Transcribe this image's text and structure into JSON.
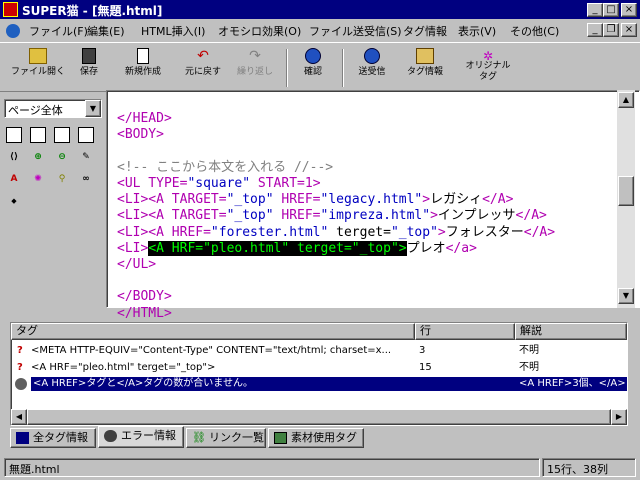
{
  "window": {
    "title": "SUPER猫 - [無題.html]",
    "min": "_",
    "max": "□",
    "close": "×"
  },
  "menubar": {
    "items": [
      "ファイル(F)",
      "編集(E)",
      "HTML挿入(I)",
      "オモシロ効果(O)",
      "ファイル送受信(S)",
      "タグ情報",
      "表示(V)",
      "その他(C)"
    ],
    "doc_min": "_",
    "doc_restore": "❐",
    "doc_close": "×"
  },
  "toolbar": {
    "open": "ファイル開く",
    "save": "保存",
    "new": "新規作成",
    "undo": "元に戻す",
    "redo": "繰り返し",
    "confirm": "確認",
    "transfer": "送受信",
    "taginfo": "タグ情報",
    "original1": "オリジナル",
    "original2": "タグ"
  },
  "leftpanel": {
    "page_select": "ページ全体"
  },
  "editor": {
    "l1": "</HEAD>",
    "l2": "<BODY>",
    "l3": "<!-- ここから本文を入れる //-->",
    "l4a": "<UL TYPE=",
    "l4b": "\"square\"",
    "l4c": " START=1>",
    "l5a": "<LI><A TARGET=",
    "l5b": "\"_top\"",
    "l5c": " HREF=",
    "l5d": "\"legacy.html\"",
    "l5e": ">",
    "l5f": "レガシィ",
    "l5g": "</A>",
    "l6a": "<LI><A TARGET=",
    "l6b": "\"_top\"",
    "l6c": " HREF=",
    "l6d": "\"impreza.html\"",
    "l6e": ">",
    "l6f": "インプレッサ",
    "l6g": "</A>",
    "l7a": "<LI><A HREF=",
    "l7b": "\"forester.html\"",
    "l7c": " terget=",
    "l7d": "\"_top\"",
    "l7e": ">",
    "l7f": "フォレスター",
    "l7g": "</A>",
    "l8a": "<LI>",
    "l8b": "<A HRF=\"pleo.html\" terget=\"_top\">",
    "l8c": "プレオ",
    "l8d": "</a>",
    "l9": "</UL>",
    "l10": "</BODY>",
    "l11": "</HTML>"
  },
  "lower": {
    "headers": {
      "tag": "タグ",
      "line": "行",
      "desc": "解説"
    },
    "rows": [
      {
        "icon": "?",
        "tag": "<META HTTP-EQUIV=\"Content-Type\" CONTENT=\"text/html; charset=x...",
        "line": "3",
        "desc": "不明"
      },
      {
        "icon": "?",
        "tag": "<A HRF=\"pleo.html\" terget=\"_top\">",
        "line": "15",
        "desc": "不明"
      },
      {
        "icon": "",
        "tag": "<A HREF>タグと</A>タグの数が合いません。",
        "line": "",
        "desc": "<A HREF>3個、</A>"
      }
    ]
  },
  "tabs": [
    "全タグ情報",
    "エラー情報",
    "リンク一覧",
    "素材使用タグ"
  ],
  "status": {
    "file": "無題.html",
    "position": "15行、38列"
  }
}
